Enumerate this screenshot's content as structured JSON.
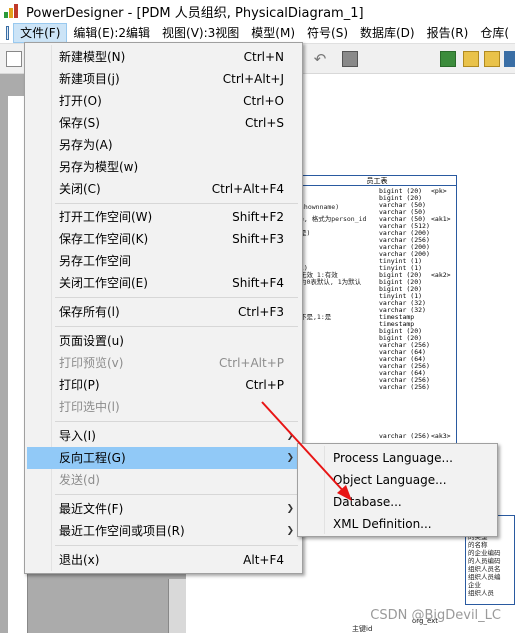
{
  "window": {
    "title": "PowerDesigner - [PDM 人员组织, PhysicalDiagram_1]"
  },
  "menubar": {
    "items": [
      "文件(F)",
      "编辑(E):2编辑",
      "视图(V):3视图",
      "模型(M)",
      "符号(S)",
      "数据库(D)",
      "报告(R)",
      "仓库("
    ]
  },
  "file_menu": {
    "items": [
      {
        "label": "新建模型(N)",
        "shortcut": "Ctrl+N"
      },
      {
        "label": "新建项目(j)",
        "shortcut": "Ctrl+Alt+J"
      },
      {
        "label": "打开(O)",
        "shortcut": "Ctrl+O"
      },
      {
        "label": "保存(S)",
        "shortcut": "Ctrl+S"
      },
      {
        "label": "另存为(A)",
        "shortcut": ""
      },
      {
        "label": "另存为模型(w)",
        "shortcut": ""
      },
      {
        "label": "关闭(C)",
        "shortcut": "Ctrl+Alt+F4"
      },
      {
        "label": "打开工作空间(W)",
        "shortcut": "Shift+F2"
      },
      {
        "label": "保存工作空间(K)",
        "shortcut": "Shift+F3"
      },
      {
        "label": "另存工作空间",
        "shortcut": ""
      },
      {
        "label": "关闭工作空间(E)",
        "shortcut": "Shift+F4"
      },
      {
        "label": "保存所有(l)",
        "shortcut": "Ctrl+F3"
      },
      {
        "label": "页面设置(u)",
        "shortcut": ""
      },
      {
        "label": "打印预览(v)",
        "shortcut": "Ctrl+Alt+P"
      },
      {
        "label": "打印(P)",
        "shortcut": "Ctrl+P"
      },
      {
        "label": "打印选中(l)",
        "shortcut": ""
      },
      {
        "label": "导入(I)",
        "shortcut": ""
      },
      {
        "label": "反向工程(G)",
        "shortcut": ""
      },
      {
        "label": "发送(d)",
        "shortcut": ""
      },
      {
        "label": "最近文件(F)",
        "shortcut": ""
      },
      {
        "label": "最近工作空间或项目(R)",
        "shortcut": ""
      },
      {
        "label": "退出(x)",
        "shortcut": "Alt+F4"
      }
    ]
  },
  "reverse_submenu": {
    "items": [
      "Process Language...",
      "Object Language...",
      "Database...",
      "XML Definition..."
    ]
  },
  "diagram": {
    "entity_title": "员工表",
    "types": [
      "bigint (20)",
      "bigint (20)",
      "varchar (50)",
      "varchar (50)",
      "varchar (50)",
      "varchar (512)",
      "varchar (200)",
      "varchar (256)",
      "varchar (200)",
      "varchar (200)",
      "tinyint (1)",
      "tinyint (1)",
      "bigint (20)",
      "bigint (20)",
      "bigint (20)",
      "tinyint (1)",
      "varchar (32)",
      "varchar (32)",
      "timestamp",
      "timestamp",
      "bigint (20)",
      "bigint (20)",
      "varchar (256)",
      "varchar (64)",
      "varchar (64)",
      "varchar (256)",
      "varchar (64)",
      "varchar (256)",
      "varchar (256)"
    ],
    "keys": [
      "<pk>",
      "<ak1>",
      "<ak2>",
      "<ak3>",
      "<ak2>"
    ],
    "fragments": [
      "shownname)",
      "e, 格式为person_id",
      "是)",
      "i)",
      "无效 1:有效",
      "为0表默认, 1为默认",
      "不是,1:是"
    ],
    "entity2_lines": [
      "型",
      "称",
      "的类型",
      "的名称",
      "的企业编码",
      "的人员编码",
      "组织人员名",
      "组织人员编",
      "企业",
      "组织人员"
    ],
    "bottom_labels": [
      "主键id",
      "org_ext"
    ]
  },
  "watermark": "CSDN @BigDevil_LC",
  "colors": {
    "menu_highlight": "#91c9f7",
    "arrow": "#e81515",
    "entity_border": "#2a5aa0",
    "disabled_text": "#8d8d8d"
  }
}
